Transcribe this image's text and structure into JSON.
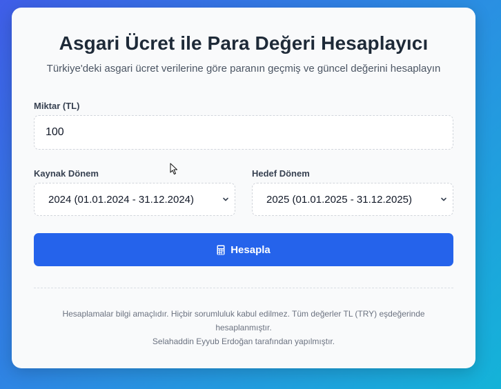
{
  "header": {
    "title": "Asgari Ücret ile Para Değeri Hesaplayıcı",
    "subtitle": "Türkiye'deki asgari ücret verilerine göre paranın geçmiş ve güncel değerini hesaplayın"
  },
  "form": {
    "amount_label": "Miktar (TL)",
    "amount_value": "100",
    "source_label": "Kaynak Dönem",
    "source_value": "2024 (01.01.2024 - 31.12.2024)",
    "target_label": "Hedef Dönem",
    "target_value": "2025 (01.01.2025 - 31.12.2025)",
    "submit_label": "Hesapla",
    "submit_icon": "calculator-icon"
  },
  "footer": {
    "disclaimer_line1": "Hesaplamalar bilgi amaçlıdır. Hiçbir sorumluluk kabul edilmez. Tüm değerler TL (TRY) eşdeğerinde hesaplanmıştır.",
    "credit": "Selahaddin Eyyub Erdoğan tarafından yapılmıştır."
  },
  "colors": {
    "accent": "#2563eb",
    "background_start": "#3f5ee8",
    "background_end": "#14b3d8",
    "card": "#f9fafb"
  }
}
